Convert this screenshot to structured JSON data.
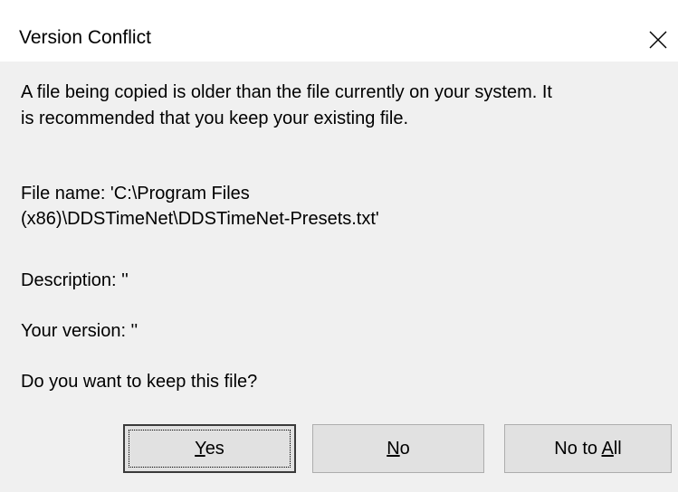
{
  "dialog": {
    "title": "Version Conflict",
    "message_line1": "A file being copied is older than the file currently on your system.  It",
    "message_line2": "is recommended that you keep your existing file.",
    "file_name_line1": "File name:   'C:\\Program Files",
    "file_name_line2": "(x86)\\DDSTimeNet\\DDSTimeNet-Presets.txt'",
    "description": "Description:  ''",
    "your_version": "Your version: ''",
    "question": "Do you want to keep this file?"
  },
  "buttons": {
    "yes": {
      "accel": "Y",
      "rest": "es"
    },
    "no": {
      "accel": "N",
      "rest": "o"
    },
    "no_to_all": {
      "pre": "No to ",
      "accel": "A",
      "rest": "ll"
    }
  },
  "icons": {
    "close": "close-icon"
  }
}
